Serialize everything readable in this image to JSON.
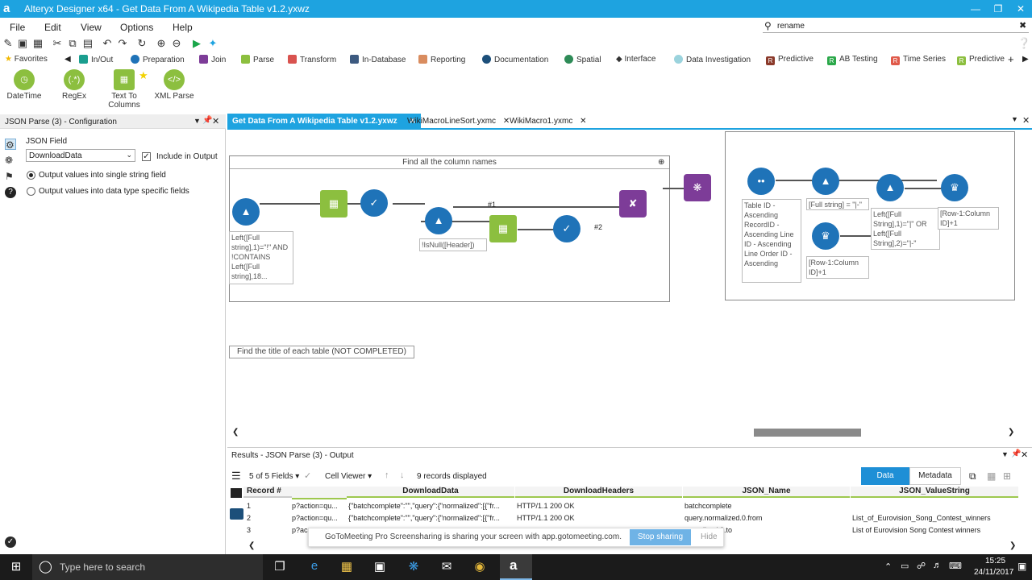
{
  "window": {
    "title": "Alteryx Designer x64 - Get Data From A Wikipedia Table v1.2.yxwz",
    "logo": "a"
  },
  "menu": [
    "File",
    "Edit",
    "View",
    "Options",
    "Help"
  ],
  "search": {
    "value": "rename"
  },
  "categories": [
    "Favorites",
    "In/Out",
    "Preparation",
    "Join",
    "Parse",
    "Transform",
    "In-Database",
    "Reporting",
    "Documentation",
    "Spatial",
    "Interface",
    "Data Investigation",
    "Predictive",
    "AB Testing",
    "Time Series",
    "Predictive"
  ],
  "palette": [
    {
      "label": "DateTime"
    },
    {
      "label": "RegEx"
    },
    {
      "label": "Text To Columns"
    },
    {
      "label": "XML Parse"
    }
  ],
  "config": {
    "pane_title": "JSON Parse (3) - Configuration",
    "field_label": "JSON Field",
    "field_value": "DownloadData",
    "include_label": "Include in Output",
    "opt1": "Output values into single string field",
    "opt2": "Output values into data type specific fields"
  },
  "tabs": [
    "Get Data From A Wikipedia Table v1.2.yxwz",
    "WikiMacroLineSort.yxmc",
    "WikiMacro1.yxmc"
  ],
  "canvas": {
    "container1": "Find all the column names",
    "container2": "Find the title of each table (NOT COMPLETED)",
    "ann_left": "Left([Full string],1)=\"!\" AND !CONTAINS Left([Full string],18...",
    "ann_isnull": "!IsNull([Header])",
    "label_h1": "#1",
    "label_h2": "#2",
    "ann_sort": "Table ID - Ascending RecordID - Ascending Line ID - Ascending Line Order ID - Ascending",
    "ann_fullstring": "[Full string] = \"|-\"",
    "ann_row1": "[Row-1:Column ID]+1",
    "ann_left2": "Left([Full String],1)=\"|\" OR Left([Full String],2)=\"|-\"",
    "ann_row2": "[Row-1:Column ID]+1"
  },
  "results": {
    "title": "Results - JSON Parse (3) - Output",
    "fields": "5 of 5 Fields",
    "viewer": "Cell Viewer",
    "count": "9 records displayed",
    "data_btn": "Data",
    "meta_btn": "Metadata",
    "columns": [
      "Record #",
      "DownloadData",
      "DownloadHeaders",
      "JSON_Name",
      "JSON_ValueString"
    ],
    "rows": [
      [
        "1",
        "p?action=qu...",
        "{\"batchcomplete\":\"\",\"query\":{\"normalized\":[{\"fr...",
        "HTTP/1.1 200 OK",
        "batchcomplete",
        ""
      ],
      [
        "2",
        "p?action=qu...",
        "{\"batchcomplete\":\"\",\"query\":{\"normalized\":[{\"fr...",
        "HTTP/1.1 200 OK",
        "query.normalized.0.from",
        "List_of_Eurovision_Song_Contest_winners"
      ],
      [
        "3",
        "p?ac",
        "",
        "",
        "alized.0.to",
        "List of Eurovision Song Contest winners"
      ]
    ]
  },
  "gotomeeting": {
    "text": "GoToMeeting Pro Screensharing is sharing your screen with app.gotomeeting.com.",
    "stop": "Stop sharing",
    "hide": "Hide"
  },
  "taskbar": {
    "search": "Type here to search",
    "time": "15:25",
    "date": "24/11/2017"
  }
}
